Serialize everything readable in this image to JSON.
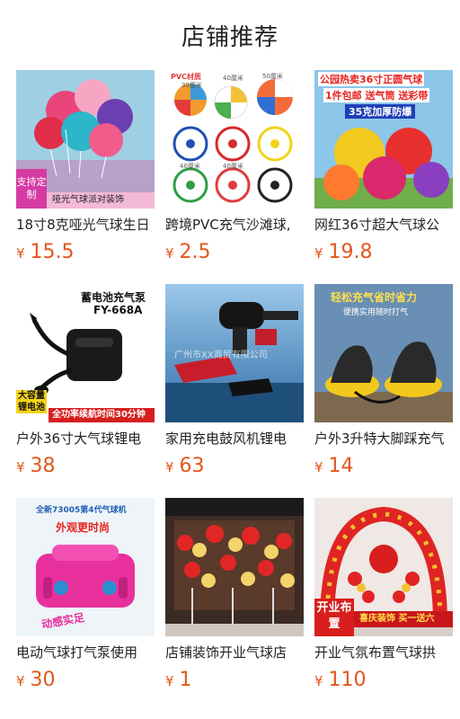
{
  "header": {
    "title": "店铺推荐"
  },
  "currency": "¥",
  "products": [
    {
      "title": "18寸8克哑光气球生日",
      "price": "15.5",
      "image": {
        "badge": "支持定制",
        "caption": "哑光气球派对装饰"
      }
    },
    {
      "title": "跨境PVC充气沙滩球,",
      "price": "2.5",
      "image": {
        "label_top": "PVC材质",
        "sizes": [
          "30厘米",
          "40厘米",
          "50厘米",
          "40厘米",
          "40厘米"
        ]
      }
    },
    {
      "title": "网红36寸超大气球公",
      "price": "19.8",
      "image": {
        "line1": "公园热卖36寸正圆气球",
        "line2": "1件包邮 送气筒 送彩带",
        "line3": "35克加厚防爆"
      }
    },
    {
      "title": "户外36寸大气球锂电",
      "price": "38",
      "image": {
        "name": "蓄电池充气泵",
        "model": "FY-668A",
        "badge": "大容量锂电池",
        "footer": "全功率续航时间30分钟"
      }
    },
    {
      "title": "家用充电鼓风机锂电",
      "price": "63",
      "image": {
        "watermark": "广州市XX商贸有限公司"
      }
    },
    {
      "title": "户外3升特大脚踩充气",
      "price": "14",
      "image": {
        "line1": "轻松充气省时省力",
        "line2": "便携实用随时打气"
      }
    },
    {
      "title": "电动气球打气泵使用",
      "price": "30",
      "image": {
        "line1": "全新73005第4代气球机",
        "line2": "外观更时尚",
        "line3": "动感实足"
      }
    },
    {
      "title": "店铺装饰开业气球店",
      "price": "1",
      "image": {}
    },
    {
      "title": "开业气氛布置气球拱",
      "price": "110",
      "image": {
        "badge": "开业布置",
        "caption": "喜庆装饰 买一送六"
      }
    }
  ],
  "colors": {
    "price": "#e2571b",
    "title": "#222222",
    "accent_pink": "#d63aa3"
  }
}
